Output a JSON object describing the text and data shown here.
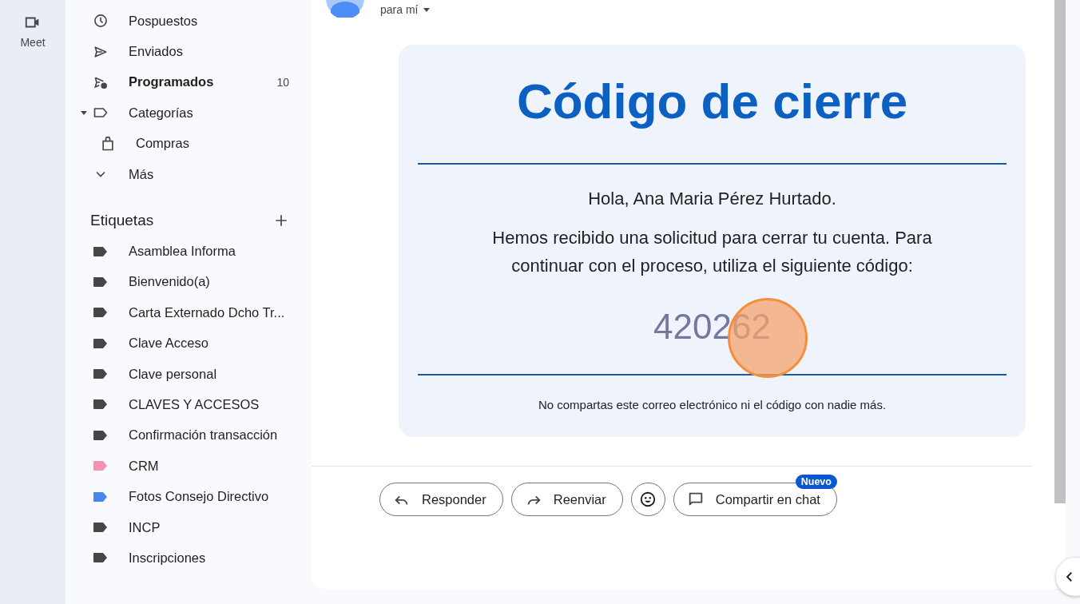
{
  "rail": {
    "items": [
      {
        "label": "Meet"
      }
    ]
  },
  "nav": [
    {
      "kind": "snoozed",
      "label": "Pospuestos",
      "unread": false
    },
    {
      "kind": "sent",
      "label": "Enviados",
      "unread": false
    },
    {
      "kind": "scheduled",
      "label": "Programados",
      "unread": true,
      "count": "10"
    },
    {
      "kind": "categories",
      "label": "Categorías",
      "unread": false,
      "expanded": true,
      "children": [
        {
          "kind": "purchases",
          "label": "Compras",
          "unread": false
        }
      ]
    },
    {
      "kind": "more",
      "label": "Más",
      "unread": false
    }
  ],
  "labels": {
    "title": "Etiquetas",
    "items": [
      {
        "label": "Asamblea Informa",
        "color": "#444746"
      },
      {
        "label": "Bienvenido(a)",
        "color": "#444746"
      },
      {
        "label": "Carta Externado Dcho Tr...",
        "color": "#444746"
      },
      {
        "label": "Clave Acceso",
        "color": "#444746"
      },
      {
        "label": "Clave personal",
        "color": "#444746"
      },
      {
        "label": "CLAVES Y ACCESOS",
        "color": "#444746"
      },
      {
        "label": "Confirmación transacción",
        "color": "#444746"
      },
      {
        "label": "CRM",
        "color": "#f691b2"
      },
      {
        "label": "Fotos Consejo Directivo",
        "color": "#4a86e8"
      },
      {
        "label": "INCP",
        "color": "#444746"
      },
      {
        "label": "Inscripciones",
        "color": "#444746"
      }
    ]
  },
  "message": {
    "recipient": "para mí",
    "body": {
      "title": "Código de cierre",
      "greeting": "Hola, Ana Maria Pérez Hurtado.",
      "text": "Hemos recibido una solicitud para cerrar tu cuenta. Para continuar con el proceso, utiliza el siguiente código:",
      "code": "420262",
      "footer": "No compartas este correo electrónico ni el código con nadie más."
    },
    "actions": [
      {
        "kind": "reply",
        "label": "Responder"
      },
      {
        "kind": "forward",
        "label": "Reenviar"
      },
      {
        "kind": "emoji"
      },
      {
        "kind": "chat",
        "label": "Compartir en chat",
        "badge": "Nuevo"
      }
    ]
  }
}
